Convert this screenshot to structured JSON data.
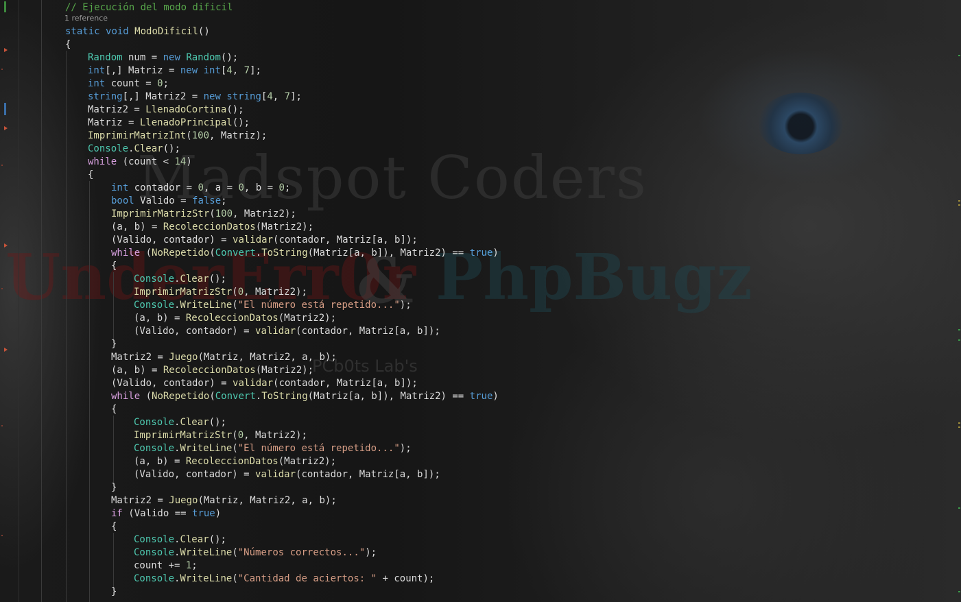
{
  "editor": {
    "reference_lens": "1 reference",
    "lines": [
      {
        "indent": 0,
        "tokens": [
          [
            "comment",
            "// Ejecución del modo dificil"
          ]
        ]
      },
      {
        "indent": 0,
        "tokens": [
          [
            "kw",
            "static"
          ],
          [
            "plain",
            " "
          ],
          [
            "kw",
            "void"
          ],
          [
            "plain",
            " "
          ],
          [
            "method",
            "ModoDificil"
          ],
          [
            "plain",
            "()"
          ]
        ]
      },
      {
        "indent": 0,
        "tokens": [
          [
            "plain",
            "{"
          ]
        ]
      },
      {
        "indent": 1,
        "tokens": [
          [
            "type",
            "Random"
          ],
          [
            "plain",
            " num = "
          ],
          [
            "kw",
            "new"
          ],
          [
            "plain",
            " "
          ],
          [
            "type",
            "Random"
          ],
          [
            "plain",
            "();"
          ]
        ]
      },
      {
        "indent": 1,
        "tokens": [
          [
            "kw",
            "int"
          ],
          [
            "plain",
            "[,] Matriz = "
          ],
          [
            "kw",
            "new"
          ],
          [
            "plain",
            " "
          ],
          [
            "kw",
            "int"
          ],
          [
            "plain",
            "["
          ],
          [
            "num",
            "4"
          ],
          [
            "plain",
            ", "
          ],
          [
            "num",
            "7"
          ],
          [
            "plain",
            "];"
          ]
        ]
      },
      {
        "indent": 1,
        "tokens": [
          [
            "kw",
            "int"
          ],
          [
            "plain",
            " count = "
          ],
          [
            "num",
            "0"
          ],
          [
            "plain",
            ";"
          ]
        ]
      },
      {
        "indent": 1,
        "tokens": [
          [
            "kw",
            "string"
          ],
          [
            "plain",
            "[,] Matriz2 = "
          ],
          [
            "kw",
            "new"
          ],
          [
            "plain",
            " "
          ],
          [
            "kw",
            "string"
          ],
          [
            "plain",
            "["
          ],
          [
            "num",
            "4"
          ],
          [
            "plain",
            ", "
          ],
          [
            "num",
            "7"
          ],
          [
            "plain",
            "];"
          ]
        ]
      },
      {
        "indent": 1,
        "tokens": [
          [
            "plain",
            "Matriz2 = "
          ],
          [
            "method",
            "LlenadoCortina"
          ],
          [
            "plain",
            "();"
          ]
        ]
      },
      {
        "indent": 1,
        "tokens": [
          [
            "plain",
            "Matriz = "
          ],
          [
            "method",
            "LlenadoPrincipal"
          ],
          [
            "plain",
            "();"
          ]
        ]
      },
      {
        "indent": 1,
        "tokens": [
          [
            "method",
            "ImprimirMatrizInt"
          ],
          [
            "plain",
            "("
          ],
          [
            "num",
            "100"
          ],
          [
            "plain",
            ", Matriz);"
          ]
        ]
      },
      {
        "indent": 1,
        "tokens": [
          [
            "type",
            "Console"
          ],
          [
            "plain",
            "."
          ],
          [
            "method",
            "Clear"
          ],
          [
            "plain",
            "();"
          ]
        ]
      },
      {
        "indent": 1,
        "tokens": [
          [
            "ctrl",
            "while"
          ],
          [
            "plain",
            " (count < "
          ],
          [
            "num",
            "14"
          ],
          [
            "plain",
            ")"
          ]
        ]
      },
      {
        "indent": 1,
        "tokens": [
          [
            "plain",
            "{"
          ]
        ]
      },
      {
        "indent": 2,
        "tokens": [
          [
            "kw",
            "int"
          ],
          [
            "plain",
            " contador = "
          ],
          [
            "num",
            "0"
          ],
          [
            "plain",
            ", a = "
          ],
          [
            "num",
            "0"
          ],
          [
            "plain",
            ", b = "
          ],
          [
            "num",
            "0"
          ],
          [
            "plain",
            ";"
          ]
        ]
      },
      {
        "indent": 2,
        "tokens": [
          [
            "kw",
            "bool"
          ],
          [
            "plain",
            " Valido = "
          ],
          [
            "kw",
            "false"
          ],
          [
            "plain",
            ";"
          ]
        ]
      },
      {
        "indent": 2,
        "tokens": [
          [
            "method",
            "ImprimirMatrizStr"
          ],
          [
            "plain",
            "("
          ],
          [
            "num",
            "100"
          ],
          [
            "plain",
            ", Matriz2);"
          ]
        ]
      },
      {
        "indent": 2,
        "tokens": [
          [
            "plain",
            "(a, b) = "
          ],
          [
            "method",
            "RecoleccionDatos"
          ],
          [
            "plain",
            "(Matriz2);"
          ]
        ]
      },
      {
        "indent": 2,
        "tokens": [
          [
            "plain",
            "(Valido, contador) = "
          ],
          [
            "method",
            "validar"
          ],
          [
            "plain",
            "(contador, Matriz[a, b]);"
          ]
        ]
      },
      {
        "indent": 2,
        "tokens": [
          [
            "ctrl",
            "while"
          ],
          [
            "plain",
            " ("
          ],
          [
            "method",
            "NoRepetido"
          ],
          [
            "plain",
            "("
          ],
          [
            "type",
            "Convert"
          ],
          [
            "plain",
            "."
          ],
          [
            "method",
            "ToString"
          ],
          [
            "plain",
            "(Matriz[a, b]), Matriz2) == "
          ],
          [
            "kw",
            "true"
          ],
          [
            "plain",
            ")"
          ]
        ]
      },
      {
        "indent": 2,
        "tokens": [
          [
            "plain",
            "{"
          ]
        ]
      },
      {
        "indent": 3,
        "tokens": [
          [
            "type",
            "Console"
          ],
          [
            "plain",
            "."
          ],
          [
            "method",
            "Clear"
          ],
          [
            "plain",
            "();"
          ]
        ]
      },
      {
        "indent": 3,
        "tokens": [
          [
            "method",
            "ImprimirMatrizStr"
          ],
          [
            "plain",
            "("
          ],
          [
            "num",
            "0"
          ],
          [
            "plain",
            ", Matriz2);"
          ]
        ]
      },
      {
        "indent": 3,
        "tokens": [
          [
            "type",
            "Console"
          ],
          [
            "plain",
            "."
          ],
          [
            "method",
            "WriteLine"
          ],
          [
            "plain",
            "("
          ],
          [
            "str",
            "\"El número está repetido...\""
          ],
          [
            "plain",
            ");"
          ]
        ]
      },
      {
        "indent": 3,
        "tokens": [
          [
            "plain",
            "(a, b) = "
          ],
          [
            "method",
            "RecoleccionDatos"
          ],
          [
            "plain",
            "(Matriz2);"
          ]
        ]
      },
      {
        "indent": 3,
        "tokens": [
          [
            "plain",
            "(Valido, contador) = "
          ],
          [
            "method",
            "validar"
          ],
          [
            "plain",
            "(contador, Matriz[a, b]);"
          ]
        ]
      },
      {
        "indent": 2,
        "tokens": [
          [
            "plain",
            "}"
          ]
        ]
      },
      {
        "indent": 2,
        "tokens": [
          [
            "plain",
            "Matriz2 = "
          ],
          [
            "method",
            "Juego"
          ],
          [
            "plain",
            "(Matriz, Matriz2, a, b);"
          ]
        ]
      },
      {
        "indent": 2,
        "tokens": [
          [
            "plain",
            "(a, b) = "
          ],
          [
            "method",
            "RecoleccionDatos"
          ],
          [
            "plain",
            "(Matriz2);"
          ]
        ]
      },
      {
        "indent": 2,
        "tokens": [
          [
            "plain",
            "(Valido, contador) = "
          ],
          [
            "method",
            "validar"
          ],
          [
            "plain",
            "(contador, Matriz[a, b]);"
          ]
        ]
      },
      {
        "indent": 2,
        "tokens": [
          [
            "ctrl",
            "while"
          ],
          [
            "plain",
            " ("
          ],
          [
            "method",
            "NoRepetido"
          ],
          [
            "plain",
            "("
          ],
          [
            "type",
            "Convert"
          ],
          [
            "plain",
            "."
          ],
          [
            "method",
            "ToString"
          ],
          [
            "plain",
            "(Matriz[a, b]), Matriz2) == "
          ],
          [
            "kw",
            "true"
          ],
          [
            "plain",
            ")"
          ]
        ]
      },
      {
        "indent": 2,
        "tokens": [
          [
            "plain",
            "{"
          ]
        ]
      },
      {
        "indent": 3,
        "tokens": [
          [
            "type",
            "Console"
          ],
          [
            "plain",
            "."
          ],
          [
            "method",
            "Clear"
          ],
          [
            "plain",
            "();"
          ]
        ]
      },
      {
        "indent": 3,
        "tokens": [
          [
            "method",
            "ImprimirMatrizStr"
          ],
          [
            "plain",
            "("
          ],
          [
            "num",
            "0"
          ],
          [
            "plain",
            ", Matriz2);"
          ]
        ]
      },
      {
        "indent": 3,
        "tokens": [
          [
            "type",
            "Console"
          ],
          [
            "plain",
            "."
          ],
          [
            "method",
            "WriteLine"
          ],
          [
            "plain",
            "("
          ],
          [
            "str",
            "\"El número está repetido...\""
          ],
          [
            "plain",
            ");"
          ]
        ]
      },
      {
        "indent": 3,
        "tokens": [
          [
            "plain",
            "(a, b) = "
          ],
          [
            "method",
            "RecoleccionDatos"
          ],
          [
            "plain",
            "(Matriz2);"
          ]
        ]
      },
      {
        "indent": 3,
        "tokens": [
          [
            "plain",
            "(Valido, contador) = "
          ],
          [
            "method",
            "validar"
          ],
          [
            "plain",
            "(contador, Matriz[a, b]);"
          ]
        ]
      },
      {
        "indent": 2,
        "tokens": [
          [
            "plain",
            "}"
          ]
        ]
      },
      {
        "indent": 2,
        "tokens": [
          [
            "plain",
            "Matriz2 = "
          ],
          [
            "method",
            "Juego"
          ],
          [
            "plain",
            "(Matriz, Matriz2, a, b);"
          ]
        ]
      },
      {
        "indent": 2,
        "tokens": [
          [
            "ctrl",
            "if"
          ],
          [
            "plain",
            " (Valido == "
          ],
          [
            "kw",
            "true"
          ],
          [
            "plain",
            ")"
          ]
        ]
      },
      {
        "indent": 2,
        "tokens": [
          [
            "plain",
            "{"
          ]
        ]
      },
      {
        "indent": 3,
        "tokens": [
          [
            "type",
            "Console"
          ],
          [
            "plain",
            "."
          ],
          [
            "method",
            "Clear"
          ],
          [
            "plain",
            "();"
          ]
        ]
      },
      {
        "indent": 3,
        "tokens": [
          [
            "type",
            "Console"
          ],
          [
            "plain",
            "."
          ],
          [
            "method",
            "WriteLine"
          ],
          [
            "plain",
            "("
          ],
          [
            "str",
            "\"Números correctos...\""
          ],
          [
            "plain",
            ");"
          ]
        ]
      },
      {
        "indent": 3,
        "tokens": [
          [
            "plain",
            "count += "
          ],
          [
            "num",
            "1"
          ],
          [
            "plain",
            ";"
          ]
        ]
      },
      {
        "indent": 3,
        "tokens": [
          [
            "type",
            "Console"
          ],
          [
            "plain",
            "."
          ],
          [
            "method",
            "WriteLine"
          ],
          [
            "plain",
            "("
          ],
          [
            "str",
            "\"Cantidad de aciertos: \""
          ],
          [
            "plain",
            " + count);"
          ]
        ]
      },
      {
        "indent": 2,
        "tokens": [
          [
            "plain",
            "}"
          ]
        ]
      }
    ]
  },
  "background": {
    "watermark_title": "Madspot Coders",
    "watermark_left": "UnderErr0r",
    "watermark_amp": "&",
    "watermark_right": "PhpBugz",
    "watermark_small": "PCb0ts Lab's"
  },
  "colors": {
    "comment": "#57a64a",
    "keyword": "#569cd6",
    "control": "#d8a0df",
    "type": "#4ec9b0",
    "method": "#dcdcaa",
    "number": "#b5cea8",
    "string": "#d69d85",
    "text": "#dcdcdc"
  }
}
